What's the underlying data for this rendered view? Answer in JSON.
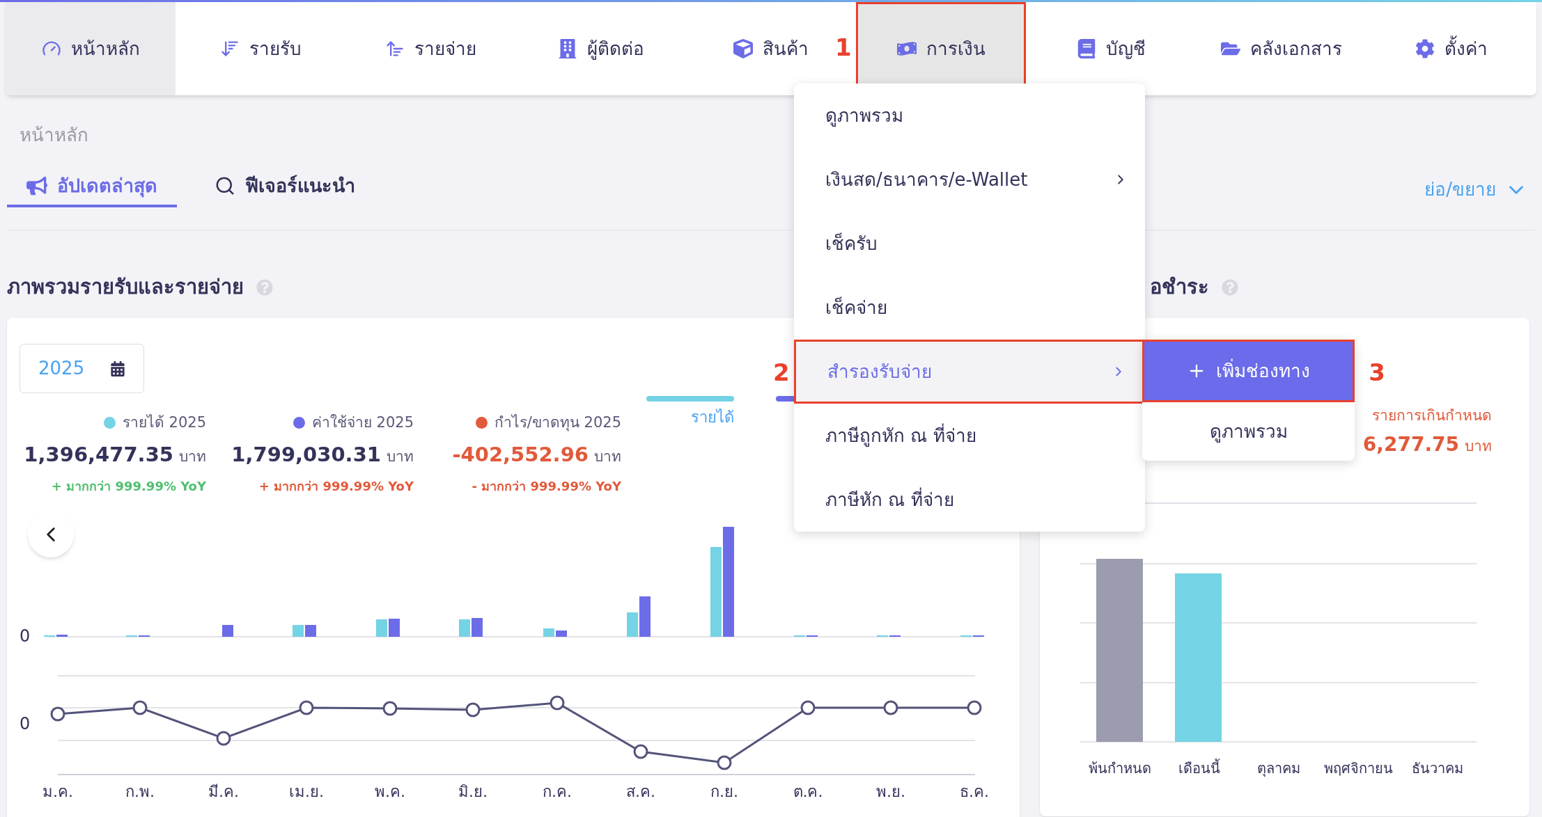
{
  "nav": [
    {
      "label": "หน้าหลัก",
      "selected": true,
      "open": false
    },
    {
      "label": "รายรับ",
      "selected": false,
      "open": false
    },
    {
      "label": "รายจ่าย",
      "selected": false,
      "open": false
    },
    {
      "label": "ผู้ติดต่อ",
      "selected": false,
      "open": false
    },
    {
      "label": "สินค้า",
      "selected": false,
      "open": false
    },
    {
      "label": "การเงิน",
      "selected": false,
      "open": true,
      "callout": "1"
    },
    {
      "label": "บัญชี",
      "selected": false,
      "open": false
    },
    {
      "label": "คลังเอกสาร",
      "selected": false,
      "open": false
    },
    {
      "label": "ตั้งค่า",
      "selected": false,
      "open": false
    }
  ],
  "breadcrumb": "หน้าหลัก",
  "tabs": [
    {
      "label": "อัปเดตล่าสุด",
      "selected": true
    },
    {
      "label": "ฟีเจอร์แนะนำ",
      "selected": false
    }
  ],
  "collapse_toggle": "ย่อ/ขยาย",
  "income_expense": {
    "title": "ภาพรวมรายรับและรายจ่าย",
    "year": "2025",
    "stats": [
      {
        "label": "รายได้ 2025",
        "color": "#74d3e4",
        "value": "1,396,477.35",
        "unit": "บาท",
        "change": "+ มากกว่า 999.99% YoY"
      },
      {
        "label": "ค่าใช้จ่าย 2025",
        "color": "#6c6ce8",
        "value": "1,799,030.31",
        "unit": "บาท",
        "change": "+ มากกว่า 999.99% YoY"
      },
      {
        "label": "กำไร/ขาดทุน 2025",
        "color": "#e15a3a",
        "value": "-402,552.96",
        "unit": "บาท",
        "change": "- มากกว่า 999.99% YoY"
      }
    ],
    "legend": [
      {
        "label": "รายได้",
        "color": "#74d3e4"
      },
      {
        "color": "#6c6ce8"
      }
    ],
    "bar_axis_label": "0",
    "line_axis_label": "0",
    "months": [
      "ม.ค.",
      "ก.พ.",
      "มี.ค.",
      "เม.ย.",
      "พ.ค.",
      "มิ.ย.",
      "ก.ค.",
      "ส.ค.",
      "ก.ย.",
      "ต.ค.",
      "พ.ย.",
      "ธ.ค."
    ]
  },
  "payables": {
    "title": "อชำระ",
    "overdue_label": "รายการเกินกำหนด",
    "overdue_amount": "6,277.75",
    "unit": "บาท",
    "categories": [
      "พ้นกำหนด",
      "เดือนนี้",
      "ตุลาคม",
      "พฤศจิกายน",
      "ธันวาคม"
    ]
  },
  "menu": {
    "items": [
      {
        "label": "ดูภาพรวม",
        "has_submenu": false,
        "selected": false
      },
      {
        "label": "เงินสด/ธนาคาร/e-Wallet",
        "has_submenu": true,
        "selected": false
      },
      {
        "label": "เช็ครับ",
        "has_submenu": false,
        "selected": false
      },
      {
        "label": "เช็คจ่าย",
        "has_submenu": false,
        "selected": false
      },
      {
        "label": "สำรองรับจ่าย",
        "has_submenu": true,
        "selected": true,
        "callout": "2"
      },
      {
        "label": "ภาษีถูกหัก ณ ที่จ่าย",
        "has_submenu": false,
        "selected": false
      },
      {
        "label": "ภาษีหัก ณ ที่จ่าย",
        "has_submenu": false,
        "selected": false
      }
    ]
  },
  "submenu": {
    "items": [
      {
        "label": "เพิ่มช่องทาง",
        "kind": "primary",
        "callout": "3"
      },
      {
        "label": "ดูภาพรวม",
        "kind": "plain"
      }
    ]
  }
}
